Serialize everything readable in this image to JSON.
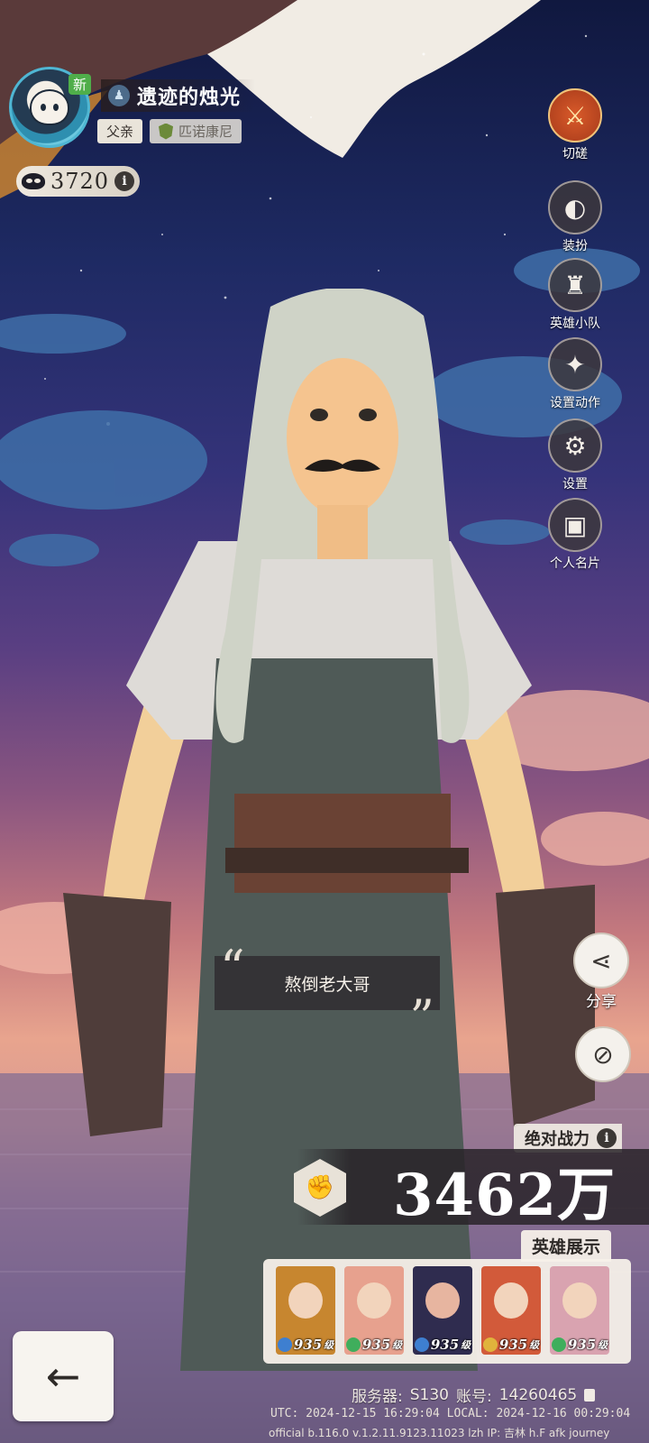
{
  "profile": {
    "new_badge": "新",
    "player_name": "遗迹的烛光",
    "title_tag": "父亲",
    "guild_name": "匹诺康尼",
    "mask_count": "3720",
    "info_glyph": "i"
  },
  "side_menu": [
    {
      "label": "切磋",
      "icon": "crossed-swords-icon"
    },
    {
      "label": "装扮",
      "icon": "mask-icon"
    },
    {
      "label": "英雄小队",
      "icon": "squad-icon"
    },
    {
      "label": "设置动作",
      "icon": "pose-icon"
    },
    {
      "label": "设置",
      "icon": "gear-icon"
    },
    {
      "label": "个人名片",
      "icon": "id-card-icon"
    }
  ],
  "quote": {
    "text": "熬倒老大哥",
    "open_mark": "“",
    "close_mark": "”"
  },
  "share": {
    "label": "分享",
    "icon": "share-icon",
    "hide_icon": "eye-hide-icon"
  },
  "power": {
    "label": "绝对战力",
    "info_glyph": "i",
    "value": "3462万",
    "icon": "fist-icon"
  },
  "heroes": {
    "label": "英雄展示",
    "cards": [
      {
        "level": "935",
        "unit": "级",
        "bg": "#c7862f",
        "faction_color": "#3e7fd0"
      },
      {
        "level": "935",
        "unit": "级",
        "bg": "#e7a18e",
        "faction_color": "#3fae5c"
      },
      {
        "level": "935",
        "unit": "级",
        "bg": "#2f2c4f",
        "faction_color": "#3e7fd0"
      },
      {
        "level": "935",
        "unit": "级",
        "bg": "#d25a3a",
        "faction_color": "#e0b33c"
      },
      {
        "level": "935",
        "unit": "级",
        "bg": "#d9a3b0",
        "faction_color": "#3fae5c"
      }
    ]
  },
  "back": {
    "icon": "back-arrow-icon",
    "glyph": "←"
  },
  "footer": {
    "server_label": "服务器:",
    "server_value": "S130",
    "account_label": "账号:",
    "account_value": "14260465",
    "utc_line": "UTC: 2024-12-15 16:29:04 LOCAL: 2024-12-16 00:29:04",
    "build_line": "official b.116.0 v.1.2.11.9123.11023 lzh IP: 吉林 h.F afk journey"
  },
  "colors": {
    "accent": "#d95a2a",
    "panel": "#f5f0e9",
    "dark_panel": "#2d282d"
  }
}
